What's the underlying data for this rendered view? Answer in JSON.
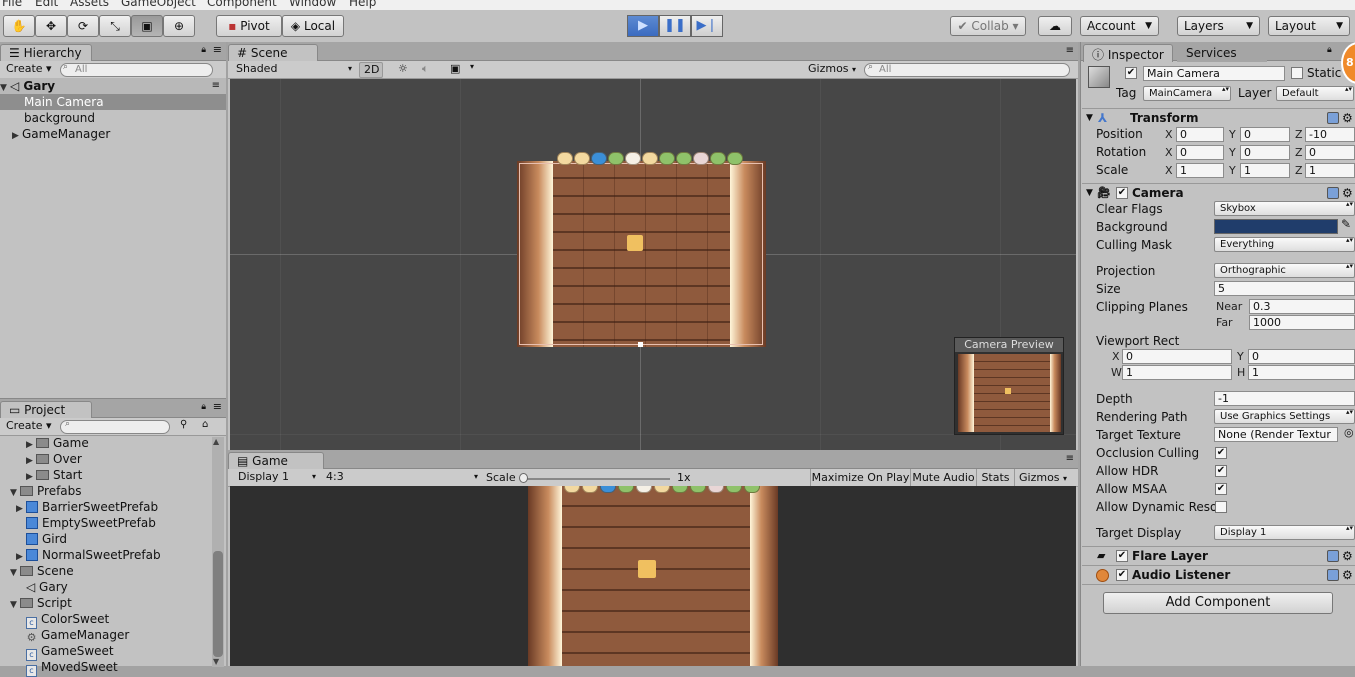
{
  "menu": {
    "items": [
      "File",
      "Edit",
      "Assets",
      "GameObject",
      "Component",
      "Window",
      "Help"
    ]
  },
  "toolbar": {
    "pivot_label": "Pivot",
    "local_label": "Local",
    "collab_label": "Collab",
    "account_label": "Account",
    "layers_label": "Layers",
    "layout_label": "Layout"
  },
  "hierarchy": {
    "tab": "Hierarchy",
    "create_label": "Create",
    "search_placeholder": "All",
    "scene_name": "Gary",
    "items": [
      "Main Camera",
      "background",
      "GameManager"
    ]
  },
  "scene": {
    "tab": "Scene",
    "shading": "Shaded",
    "mode_2d": "2D",
    "gizmos_label": "Gizmos",
    "search_placeholder": "All",
    "camera_preview_label": "Camera Preview"
  },
  "game": {
    "tab": "Game",
    "display": "Display 1",
    "aspect": "4:3",
    "scale_label": "Scale",
    "scale_value": "1x",
    "maximize_label": "Maximize On Play",
    "mute_label": "Mute Audio",
    "stats_label": "Stats",
    "gizmos_label": "Gizmos"
  },
  "project": {
    "tab": "Project",
    "create_label": "Create",
    "items": [
      {
        "label": "Game",
        "kind": "folder",
        "level": 2,
        "arrow": "▶"
      },
      {
        "label": "Over",
        "kind": "folder",
        "level": 2,
        "arrow": "▶"
      },
      {
        "label": "Start",
        "kind": "folder",
        "level": 2,
        "arrow": "▶"
      },
      {
        "label": "Prefabs",
        "kind": "folder",
        "level": 0,
        "arrow": "▼"
      },
      {
        "label": "BarrierSweetPrefab",
        "kind": "prefab",
        "level": 1,
        "arrow": "▶"
      },
      {
        "label": "EmptySweetPrefab",
        "kind": "prefab",
        "level": 1,
        "arrow": ""
      },
      {
        "label": "Gird",
        "kind": "prefab",
        "level": 1,
        "arrow": ""
      },
      {
        "label": "NormalSweetPrefab",
        "kind": "prefab",
        "level": 1,
        "arrow": "▶"
      },
      {
        "label": "Scene",
        "kind": "folder",
        "level": 0,
        "arrow": "▼"
      },
      {
        "label": "Gary",
        "kind": "unity",
        "level": 1,
        "arrow": ""
      },
      {
        "label": "Script",
        "kind": "folder",
        "level": 0,
        "arrow": "▼"
      },
      {
        "label": "ColorSweet",
        "kind": "script",
        "level": 1,
        "arrow": ""
      },
      {
        "label": "GameManager",
        "kind": "gear",
        "level": 1,
        "arrow": ""
      },
      {
        "label": "GameSweet",
        "kind": "script",
        "level": 1,
        "arrow": ""
      },
      {
        "label": "MovedSweet",
        "kind": "script",
        "level": 1,
        "arrow": ""
      }
    ]
  },
  "inspector": {
    "tab": "Inspector",
    "tab2": "Services",
    "badge": "8",
    "object_name": "Main Camera",
    "static_label": "Static",
    "tag_label": "Tag",
    "tag_value": "MainCamera",
    "layer_label": "Layer",
    "layer_value": "Default",
    "transform": {
      "title": "Transform",
      "position_label": "Position",
      "rotation_label": "Rotation",
      "scale_label": "Scale",
      "axis_x": "X",
      "axis_y": "Y",
      "axis_z": "Z",
      "position": [
        "0",
        "0",
        "-10"
      ],
      "rotation": [
        "0",
        "0",
        "0"
      ],
      "scale": [
        "1",
        "1",
        "1"
      ]
    },
    "camera": {
      "title": "Camera",
      "clear_flags_label": "Clear Flags",
      "clear_flags_value": "Skybox",
      "background_label": "Background",
      "background_color": "#203d6b",
      "culling_label": "Culling Mask",
      "culling_value": "Everything",
      "projection_label": "Projection",
      "projection_value": "Orthographic",
      "size_label": "Size",
      "size_value": "5",
      "clipping_label": "Clipping Planes",
      "near_label": "Near",
      "near_value": "0.3",
      "far_label": "Far",
      "far_value": "1000",
      "viewport_label": "Viewport Rect",
      "vp_x_label": "X",
      "vp_x": "0",
      "vp_y_label": "Y",
      "vp_y": "0",
      "vp_w_label": "W",
      "vp_w": "1",
      "vp_h_label": "H",
      "vp_h": "1",
      "depth_label": "Depth",
      "depth_value": "-1",
      "rendering_label": "Rendering Path",
      "rendering_value": "Use Graphics Settings",
      "target_texture_label": "Target Texture",
      "target_texture_value": "None (Render Textur",
      "occlusion_label": "Occlusion Culling",
      "hdr_label": "Allow HDR",
      "msaa_label": "Allow MSAA",
      "dynres_label": "Allow Dynamic Reso",
      "target_display_label": "Target Display",
      "target_display_value": "Display 1"
    },
    "flare_title": "Flare Layer",
    "audio_title": "Audio Listener",
    "add_component_label": "Add Component"
  }
}
